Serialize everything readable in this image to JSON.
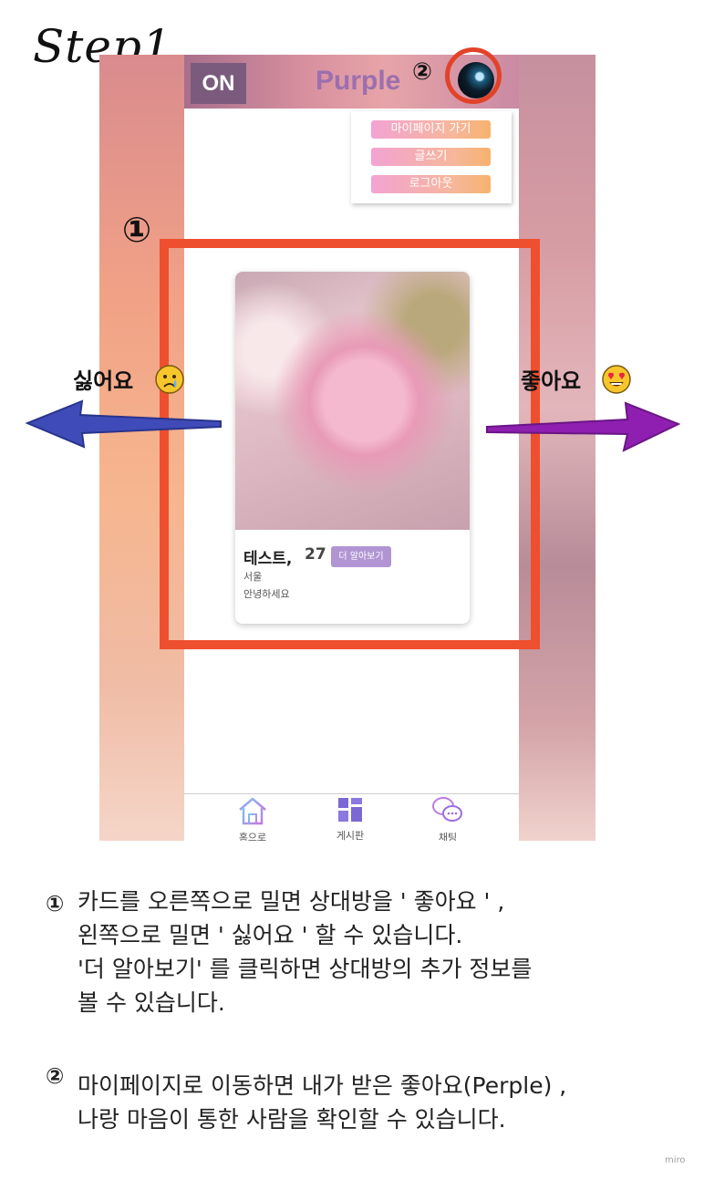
{
  "step_title": "Step1",
  "app": {
    "logo": "ON",
    "brand": "Purple",
    "menu": [
      "마이페이지 가기",
      "글쓰기",
      "로그아웃"
    ],
    "nav": [
      {
        "label": "홈으로",
        "icon": "home-icon"
      },
      {
        "label": "게시판",
        "icon": "board-grid-icon"
      },
      {
        "label": "채팅",
        "icon": "chat-bubbles-icon"
      }
    ]
  },
  "card": {
    "name": "테스트,",
    "age": "27",
    "more_button": "더 알아보기",
    "location": "서울",
    "bio": "안녕하세요"
  },
  "annotations": {
    "marker_one": "①",
    "marker_two": "②",
    "dislike": "싫어요",
    "like": "좋아요",
    "dislike_emoji": "crying-face-icon",
    "like_emoji": "heart-eyes-face-icon",
    "left_arrow_color": "#3f4bb8",
    "right_arrow_color": "#8e1fb0",
    "highlight_color": "#ee4f2e"
  },
  "descriptions": [
    {
      "marker": "①",
      "lines": [
        "카드를 오른쪽으로 밀면 상대방을 ' 좋아요 ' ,",
        "왼쪽으로 밀면 ' 싫어요 ' 할 수 있습니다.",
        "'더 알아보기' 를 클릭하면 상대방의 추가 정보를",
        "볼 수 있습니다."
      ]
    },
    {
      "marker": "②",
      "lines": [
        "마이페이지로 이동하면 내가 받은 좋아요(Perple) ,",
        "나랑 마음이 통한 사람을 확인할 수 있습니다."
      ]
    }
  ],
  "watermark": "miro"
}
